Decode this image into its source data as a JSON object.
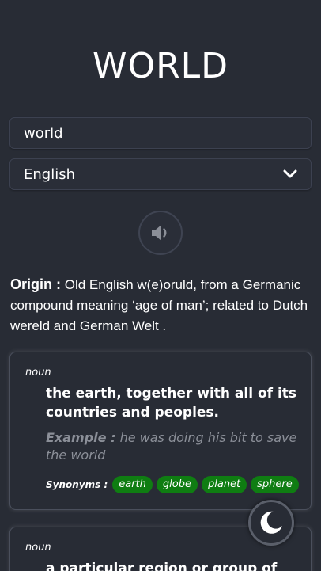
{
  "header": {
    "title": "WORLD"
  },
  "search": {
    "value": "world",
    "placeholder": ""
  },
  "language": {
    "selected": "English"
  },
  "audio": {
    "icon": "speaker-icon"
  },
  "origin": {
    "label": "Origin :",
    "text": "Old English w(e)oruld, from a Germanic compound meaning ‘age of man’; related to Dutch wereld and German Welt ."
  },
  "meanings": [
    {
      "part_of_speech": "noun",
      "definition": "the earth, together with all of its countries and peoples.",
      "example_label": "Example :",
      "example": "he was doing his bit to save the world",
      "synonyms_label": "Synonyms :",
      "synonyms": [
        "earth",
        "globe",
        "planet",
        "sphere"
      ]
    },
    {
      "part_of_speech": "noun",
      "definition": "a particular region or group of"
    }
  ],
  "theme_toggle": {
    "icon": "moon-icon"
  },
  "colors": {
    "background": "#282c35",
    "chip": "#0f7d12",
    "muted": "#8b8f98"
  }
}
